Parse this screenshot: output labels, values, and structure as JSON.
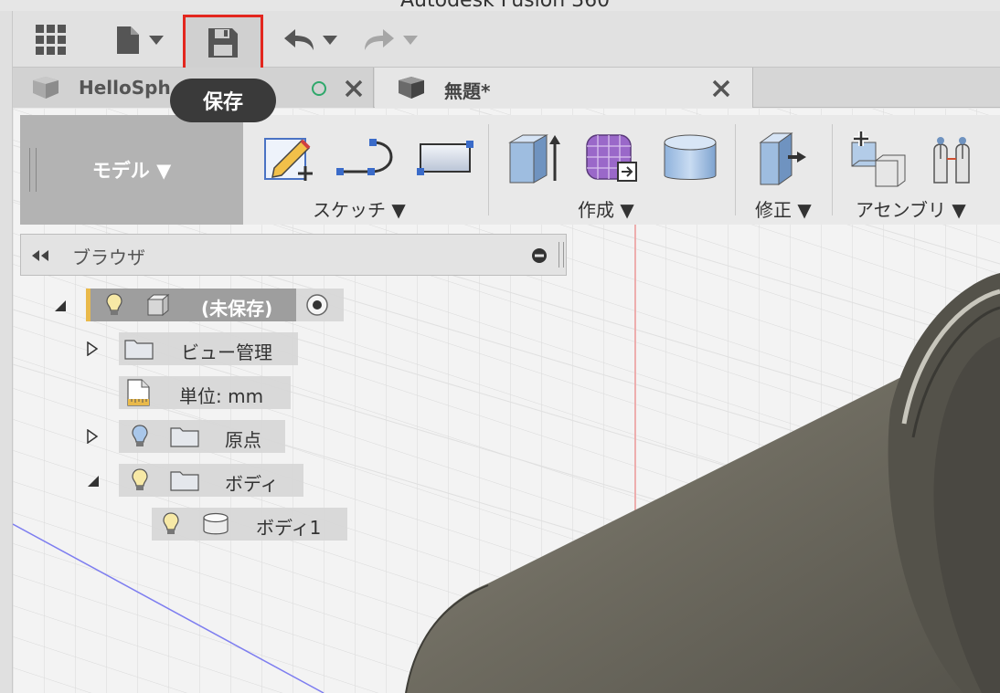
{
  "window": {
    "title": "Autodesk Fusion 360"
  },
  "toolbar": {
    "tooltip": "保存",
    "icons": [
      "grid-icon",
      "file-icon",
      "save-icon",
      "undo-icon",
      "redo-icon"
    ]
  },
  "tabs": [
    {
      "label": "HelloSph"
    },
    {
      "label": "無題*"
    }
  ],
  "ribbon": {
    "workspace": "モデル ▼",
    "groups": [
      "スケッチ ▼",
      "作成 ▼",
      "修正 ▼",
      "アセンブリ ▼"
    ]
  },
  "browser": {
    "title": "ブラウザ",
    "items": [
      {
        "label": "(未保存)"
      },
      {
        "label": "ビュー管理"
      },
      {
        "label": "単位: mm"
      },
      {
        "label": "原点"
      },
      {
        "label": "ボディ"
      },
      {
        "label": "ボディ1"
      }
    ]
  },
  "colors": {
    "highlight": "#e3261e",
    "tooltip_bg": "#3a3a3a",
    "workspace_bg": "#b3b3b3",
    "model_body": "#6f6c60"
  }
}
